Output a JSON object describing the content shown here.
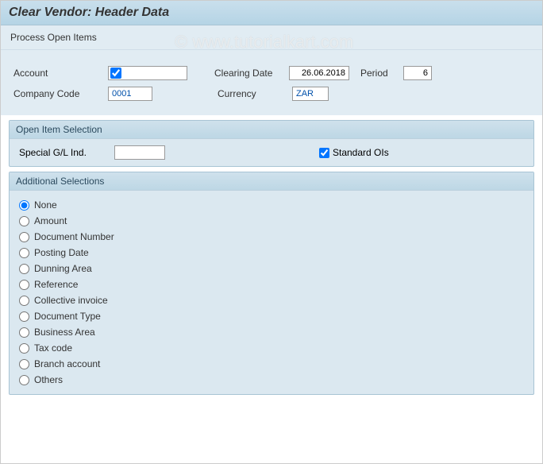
{
  "header": {
    "title": "Clear Vendor: Header Data"
  },
  "toolbar": {
    "process_open_items": "Process Open Items"
  },
  "form": {
    "account_label": "Account",
    "account_value": "",
    "clearing_date_label": "Clearing Date",
    "clearing_date_value": "26.06.2018",
    "period_label": "Period",
    "period_value": "6",
    "company_code_label": "Company Code",
    "company_code_value": "0001",
    "currency_label": "Currency",
    "currency_value": "ZAR"
  },
  "open_items": {
    "legend": "Open Item Selection",
    "special_gl_label": "Special G/L Ind.",
    "special_gl_value": "",
    "standard_ois_label": "Standard OIs",
    "standard_ois_checked": true
  },
  "additional": {
    "legend": "Additional Selections",
    "options": [
      "None",
      "Amount",
      "Document Number",
      "Posting Date",
      "Dunning Area",
      "Reference",
      "Collective invoice",
      "Document Type",
      "Business Area",
      "Tax code",
      "Branch account",
      "Others"
    ],
    "selected": "None"
  },
  "watermark": "© www.tutorialkart.com"
}
